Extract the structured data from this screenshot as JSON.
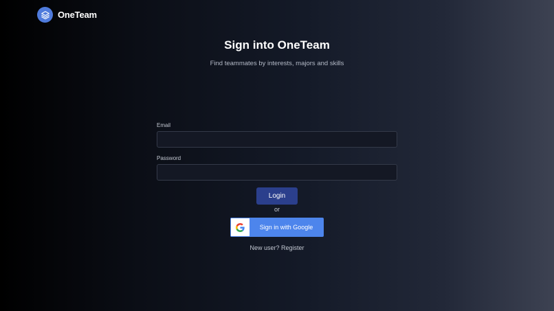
{
  "brand": {
    "name": "OneTeam",
    "logo_icon": "layers-icon",
    "logo_color": "#4f7bdc"
  },
  "header": {
    "title": "Sign into OneTeam",
    "subtitle": "Find teammates by interests, majors and skills"
  },
  "form": {
    "email_label": "Email",
    "email_value": "",
    "password_label": "Password",
    "password_value": "",
    "login_label": "Login",
    "or_text": "or",
    "google_label": "Sign in with Google",
    "google_icon": "google-g-icon"
  },
  "footer": {
    "new_user_text": "New user?",
    "register_label": "Register"
  },
  "colors": {
    "login_button": "#2b3f8c",
    "google_button": "#4d85ec",
    "input_background": "#141824"
  }
}
